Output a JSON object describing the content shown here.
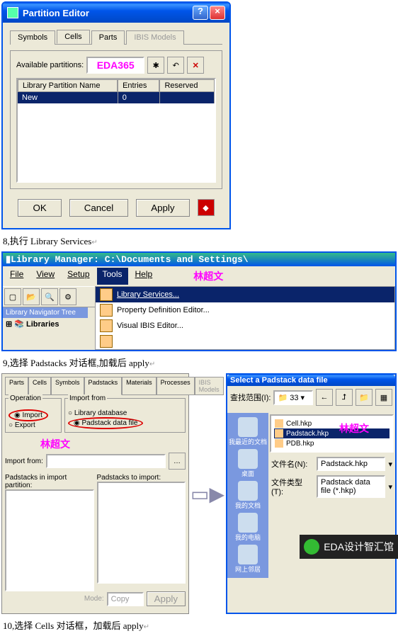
{
  "window1": {
    "title": "Partition Editor",
    "tabs": [
      "Symbols",
      "Cells",
      "Parts",
      "IBIS Models"
    ],
    "available_label": "Available partitions:",
    "watermark": "EDA365",
    "table": {
      "cols": [
        "Library Partition Name",
        "Entries",
        "Reserved"
      ],
      "row": {
        "name": "New",
        "entries": "0",
        "reserved": ""
      }
    },
    "buttons": {
      "ok": "OK",
      "cancel": "Cancel",
      "apply": "Apply"
    }
  },
  "caption1": "8,执行 Library Services",
  "window2": {
    "title": "Library Manager: C:\\Documents and Settings\\",
    "menus": [
      "File",
      "View",
      "Setup",
      "Tools",
      "Help"
    ],
    "watermark": "林超文",
    "nav_tab": "Library Navigator Tree",
    "nav_item": "Libraries",
    "items": [
      "Library Services...",
      "Property Definition Editor...",
      "Visual IBIS Editor..."
    ]
  },
  "caption2": "9,选择 Padstacks 对话框,加载后 apply",
  "dialog3": {
    "tabs": [
      "Parts",
      "Cells",
      "Symbols",
      "Padstacks",
      "Materials",
      "Processes",
      "IBIS Models"
    ],
    "operation_legend": "Operation",
    "op_import": "Import",
    "op_export": "Export",
    "importfrom_legend": "Import from",
    "if_lib": "Library database",
    "if_file": "Padstack data file",
    "watermark": "林超文",
    "import_from_label": "Import from:",
    "list1": "Padstacks in import partition:",
    "list2": "Padstacks to import:",
    "mode": "Mode:",
    "copy": "Copy",
    "apply": "Apply"
  },
  "filedlg": {
    "title": "Select a Padstack data file",
    "look_label": "查找范围(I):",
    "look_value": "33",
    "places": [
      "我最近的文档",
      "桌面",
      "我的文档",
      "我的电脑",
      "网上邻居"
    ],
    "files": [
      "Cell.hkp",
      "Padstack.hkp",
      "PDB.hkp"
    ],
    "watermark": "林超文",
    "name_label": "文件名(N):",
    "name_value": "Padstack.hkp",
    "type_label": "文件类型(T):",
    "type_value": "Padstack data file (*.hkp)"
  },
  "caption3": "10,选择 Cells 对话框，加载后 apply",
  "footer": "EDA设计智汇馆"
}
